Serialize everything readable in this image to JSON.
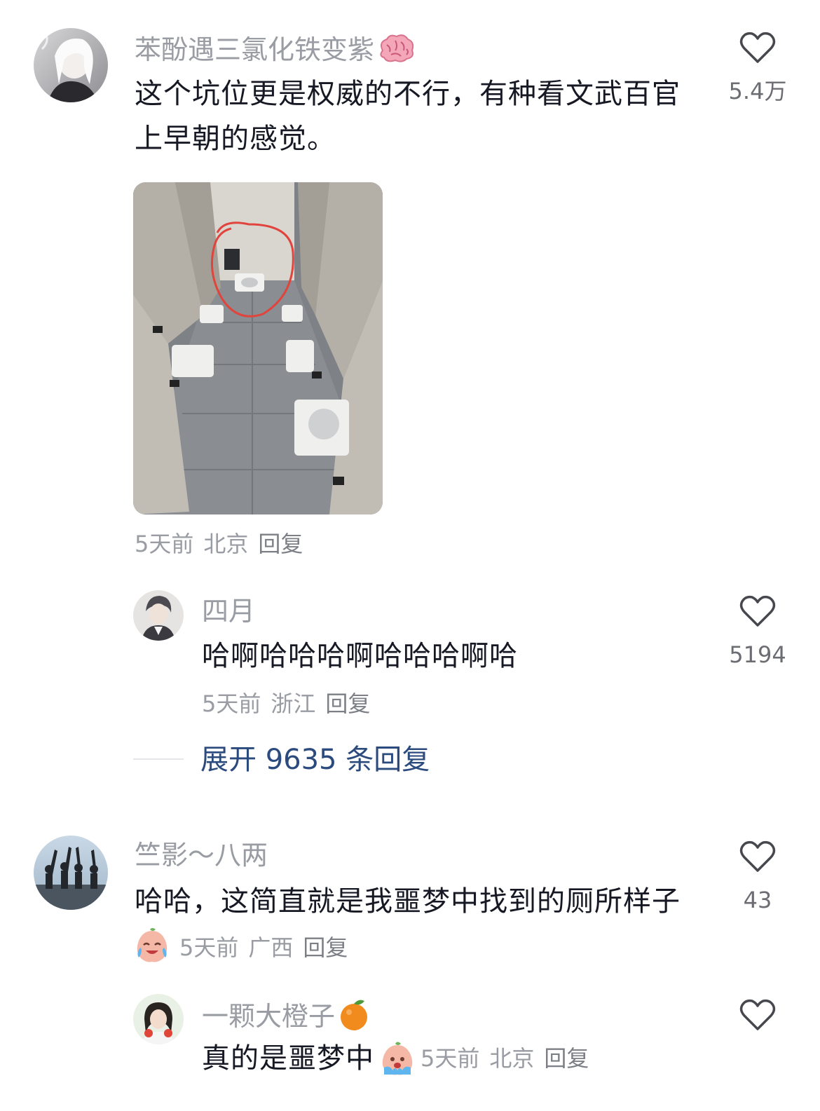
{
  "comments": [
    {
      "username": "苯酚遇三氯化铁变紫",
      "username_emoji": "brain-emoji",
      "text_line1": "这个坑位更是权威的不行，有种看文武百官",
      "text_line2": "上早朝的感觉。",
      "likes": "5.4万",
      "time": "5天前",
      "location": "北京",
      "reply_label": "回复",
      "has_image": true
    },
    {
      "username": "四月",
      "text": "哈啊哈哈哈啊哈哈哈啊哈",
      "likes": "5194",
      "time": "5天前",
      "location": "浙江",
      "reply_label": "回复"
    },
    {
      "username": "竺影～八两",
      "text": "哈哈，这简直就是我噩梦中找到的厕所样子",
      "likes": "43",
      "emoji": "crying-laughing-peach-emoji",
      "time": "5天前",
      "location": "广西",
      "reply_label": "回复"
    },
    {
      "username": "一颗大橙子",
      "username_emoji": "orange-emoji",
      "text": "真的是噩梦中",
      "emoji": "crying-peach-emoji",
      "time": "5天前",
      "location": "北京",
      "reply_label": "回复"
    }
  ],
  "expand_replies": "展开 9635 条回复",
  "colors": {
    "text": "#161823",
    "muted": "#9a9ca3",
    "link": "#2b4a7e",
    "annotation_circle": "#e0443c"
  }
}
